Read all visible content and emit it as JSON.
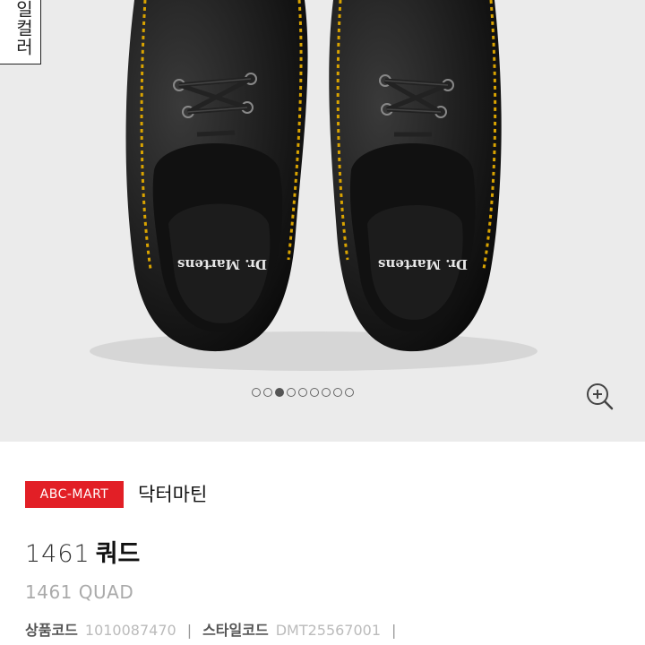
{
  "hero": {
    "vertical_label": "일컬러",
    "shoe_logo_text": "Dr. Martens",
    "carousel": {
      "total_slides": 9,
      "active_index": 2
    },
    "zoom_icon": "zoom-in-icon"
  },
  "product": {
    "badge": "ABC-MART",
    "brand": "닥터마틴",
    "model_number": "1461",
    "name": "쿼드",
    "subtitle": "1461 QUAD",
    "product_code_label": "상품코드",
    "product_code_value": "1010087470",
    "style_code_label": "스타일코드",
    "style_code_value": "DMT25567001",
    "separator": "|"
  },
  "colors": {
    "badge_bg": "#e21f26",
    "hero_bg": "#ebebeb",
    "stitching": "#d9a300"
  }
}
